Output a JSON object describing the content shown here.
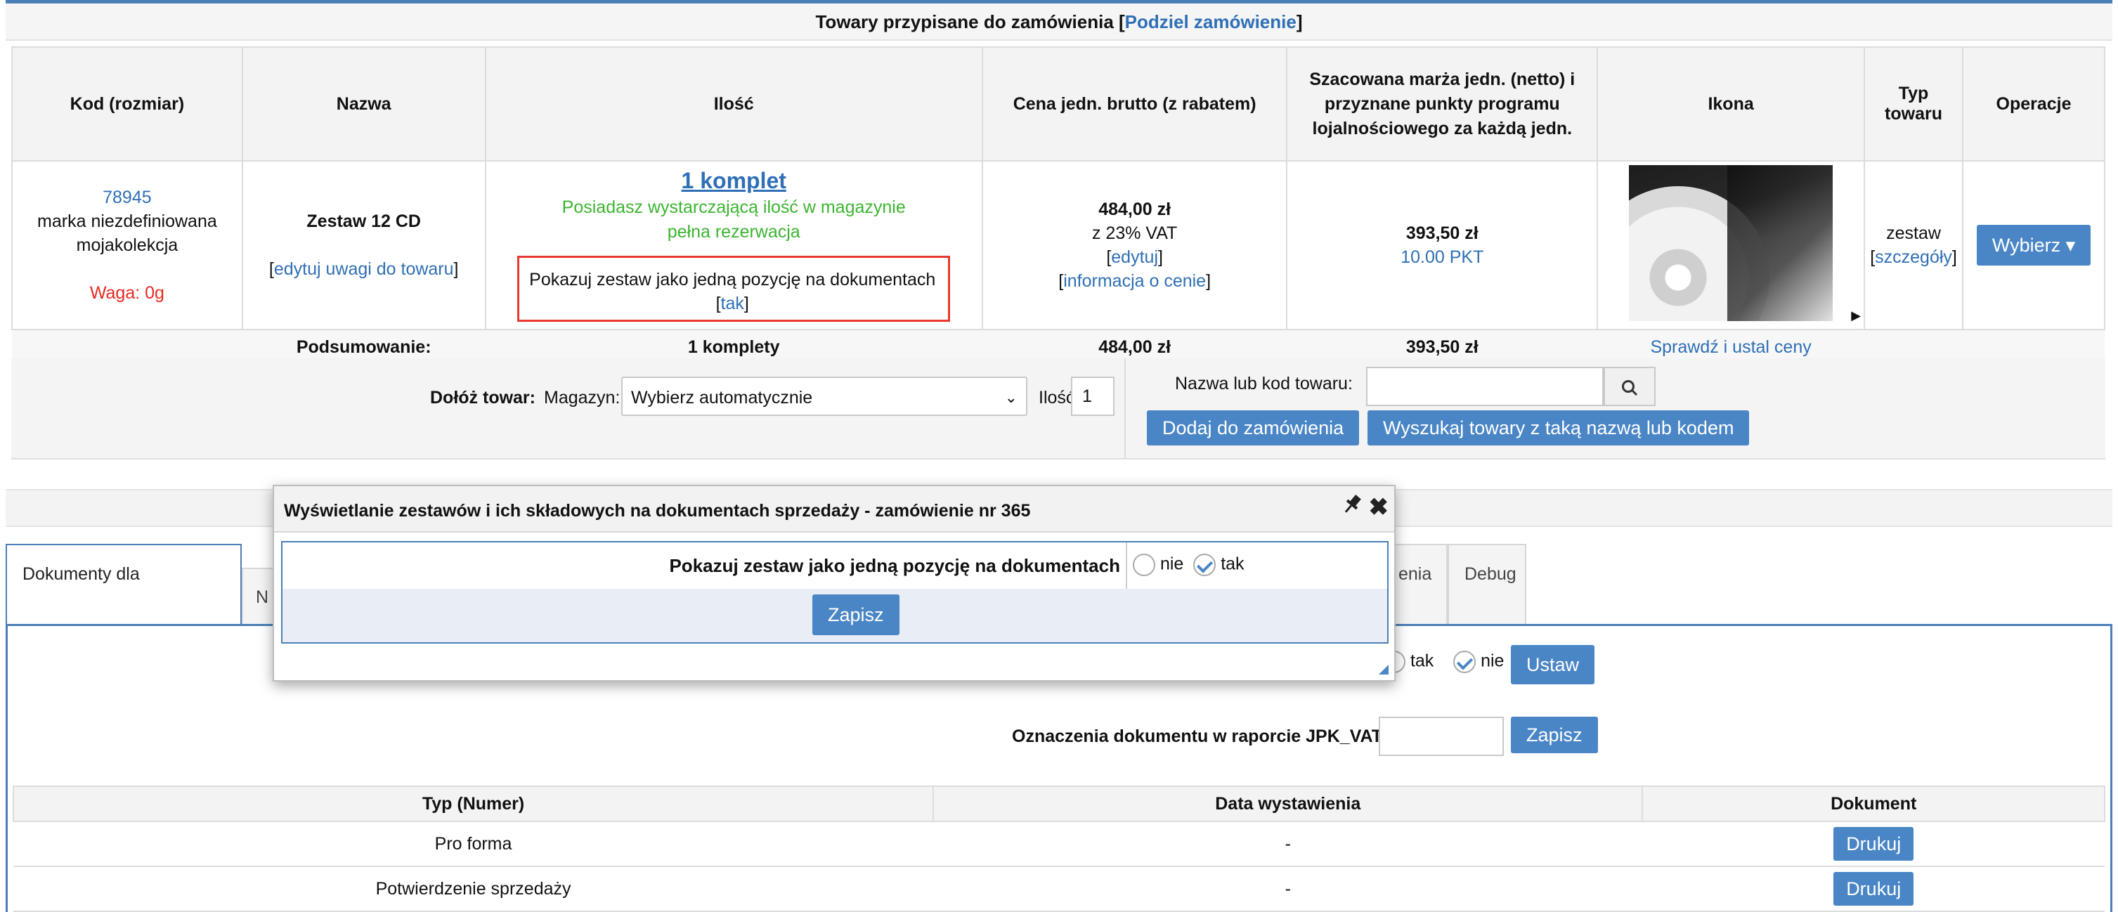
{
  "section": {
    "title": "Towary przypisane do zamówienia [",
    "title_link": "Podziel zamówienie",
    "title_end": "]"
  },
  "table": {
    "headers": [
      "Kod (rozmiar)",
      "Nazwa",
      "Ilość",
      "Cena jedn. brutto (z rabatem)",
      "Szacowana marża jedn. (netto) i przyznane punkty programu lojalnościowego za każdą jedn.",
      "Ikona",
      "Typ towaru",
      "Operacje"
    ],
    "row": {
      "code": "78945",
      "brand": "marka niezdefiniowana",
      "collection": "mojakolekcja",
      "weight": "Waga: 0g",
      "name": "Zestaw 12 CD",
      "edit_notes": "edytuj uwagi do towaru",
      "qty_link": "1 komplet",
      "stock_msg": "Posiadasz wystarczającą ilość w magazynie",
      "reservation": "pełna rezerwacja",
      "set_text": "Pokazuj zestaw jako jedną pozycję na dokumentach",
      "set_link": "tak",
      "price": "484,00 zł",
      "vat": "z 23% VAT",
      "edit_price": "edytuj",
      "price_info": "informacja o cenie",
      "margin": "393,50 zł",
      "points": "10.00 PKT",
      "type": "zestaw",
      "details": "szczegóły",
      "choose_btn": "Wybierz ▾"
    },
    "summary": {
      "label": "Podsumowanie:",
      "qty": "1 komplety",
      "price": "484,00 zł",
      "margin": "393,50 zł",
      "check_prices": "Sprawdź i ustal ceny"
    }
  },
  "add_product": {
    "label": "Dołóż towar:",
    "warehouse_label": "Magazyn:",
    "warehouse_value": "Wybierz automatycznie",
    "qty_label": "Ilość:",
    "qty_value": "1",
    "search_label": "Nazwa lub kod towaru:",
    "add_btn": "Dodaj do zamówienia",
    "search_btn": "Wyszukaj towary z taką nazwą lub kodem"
  },
  "tabs": [
    {
      "label": "Dokumenty dla zamówienia"
    },
    {
      "label": "N"
    },
    {
      "label": "enia"
    },
    {
      "label": "Debug"
    }
  ],
  "tab_content": {
    "yes": "tak",
    "no": "nie",
    "set_btn": "Ustaw",
    "jpk_label": "Oznaczenia dokumentu w raporcie JPK_VAT",
    "jpk_save": "Zapisz"
  },
  "docs": {
    "headers": [
      "Typ (Numer)",
      "Data wystawienia",
      "Dokument"
    ],
    "rows": [
      {
        "type": "Pro forma",
        "date": "-",
        "action": "Drukuj"
      },
      {
        "type": "Potwierdzenie sprzedaży",
        "date": "-",
        "action": "Drukuj"
      }
    ]
  },
  "modal": {
    "title": "Wyświetlanie zestawów i ich składowych na dokumentach sprzedaży - zamówienie nr 365",
    "question": "Pokazuj zestaw jako jedną pozycję na dokumentach",
    "opt_no": "nie",
    "opt_yes": "tak",
    "save": "Zapisz",
    "selected": "tak"
  }
}
